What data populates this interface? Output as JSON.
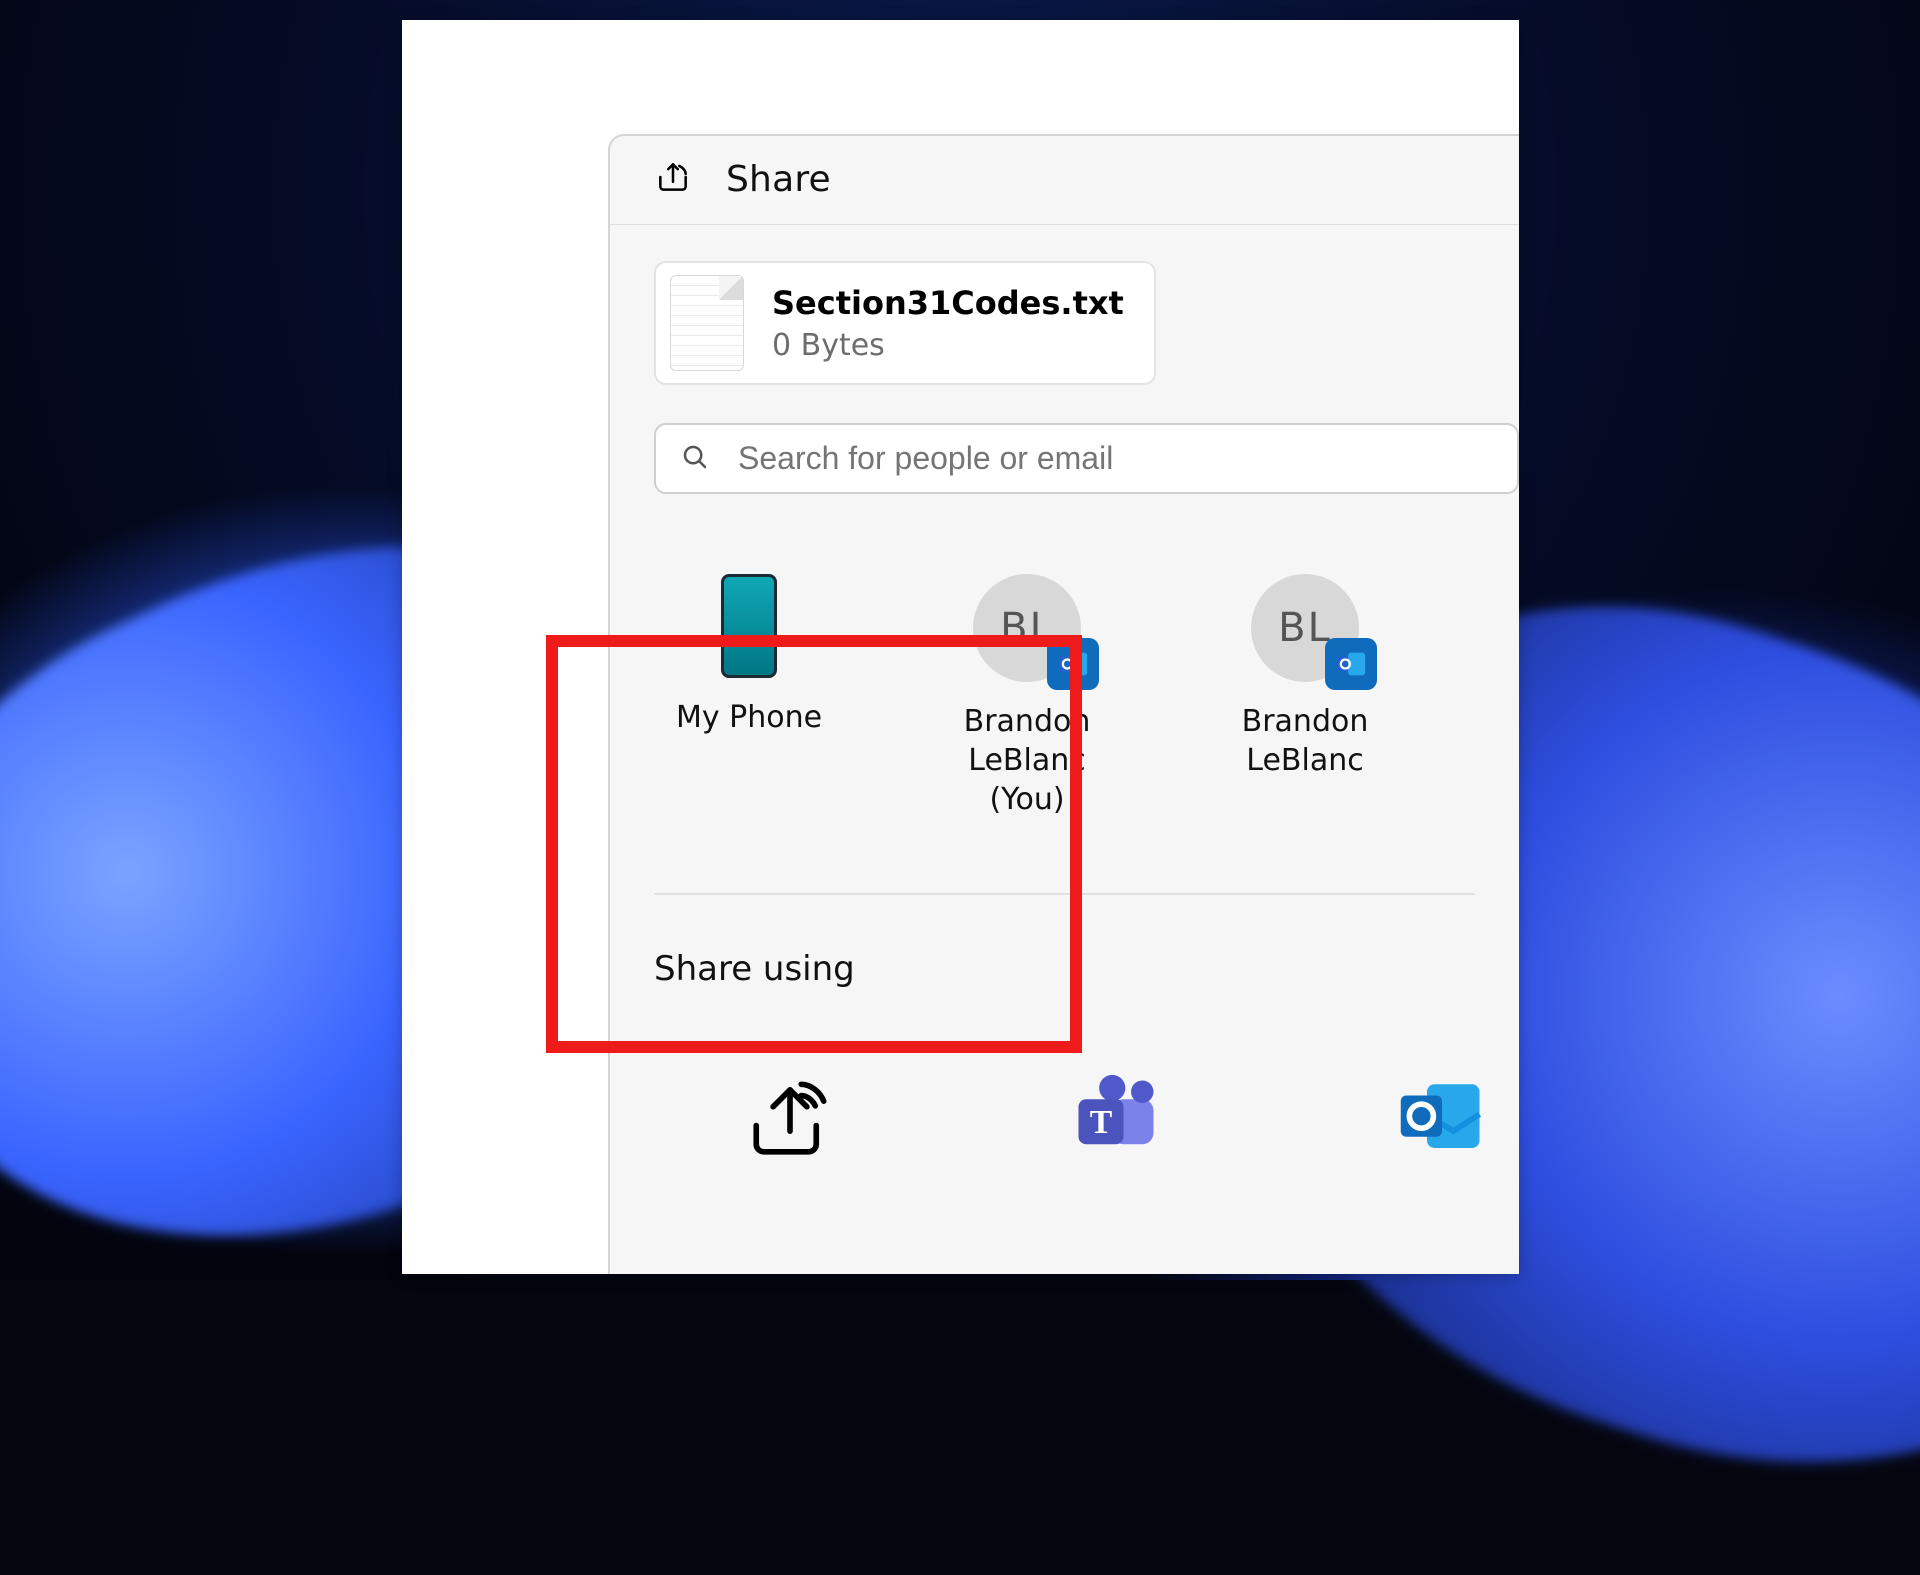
{
  "dialog": {
    "title": "Share",
    "file": {
      "name": "Section31Codes.txt",
      "size": "0 Bytes"
    },
    "search": {
      "placeholder": "Search for people or email"
    },
    "targets": [
      {
        "label": "My Phone"
      },
      {
        "initials": "BL",
        "label": "Brandon LeBlanc (You)"
      },
      {
        "initials": "BL",
        "label": "Brandon LeBlanc"
      }
    ],
    "share_using_label": "Share using"
  }
}
